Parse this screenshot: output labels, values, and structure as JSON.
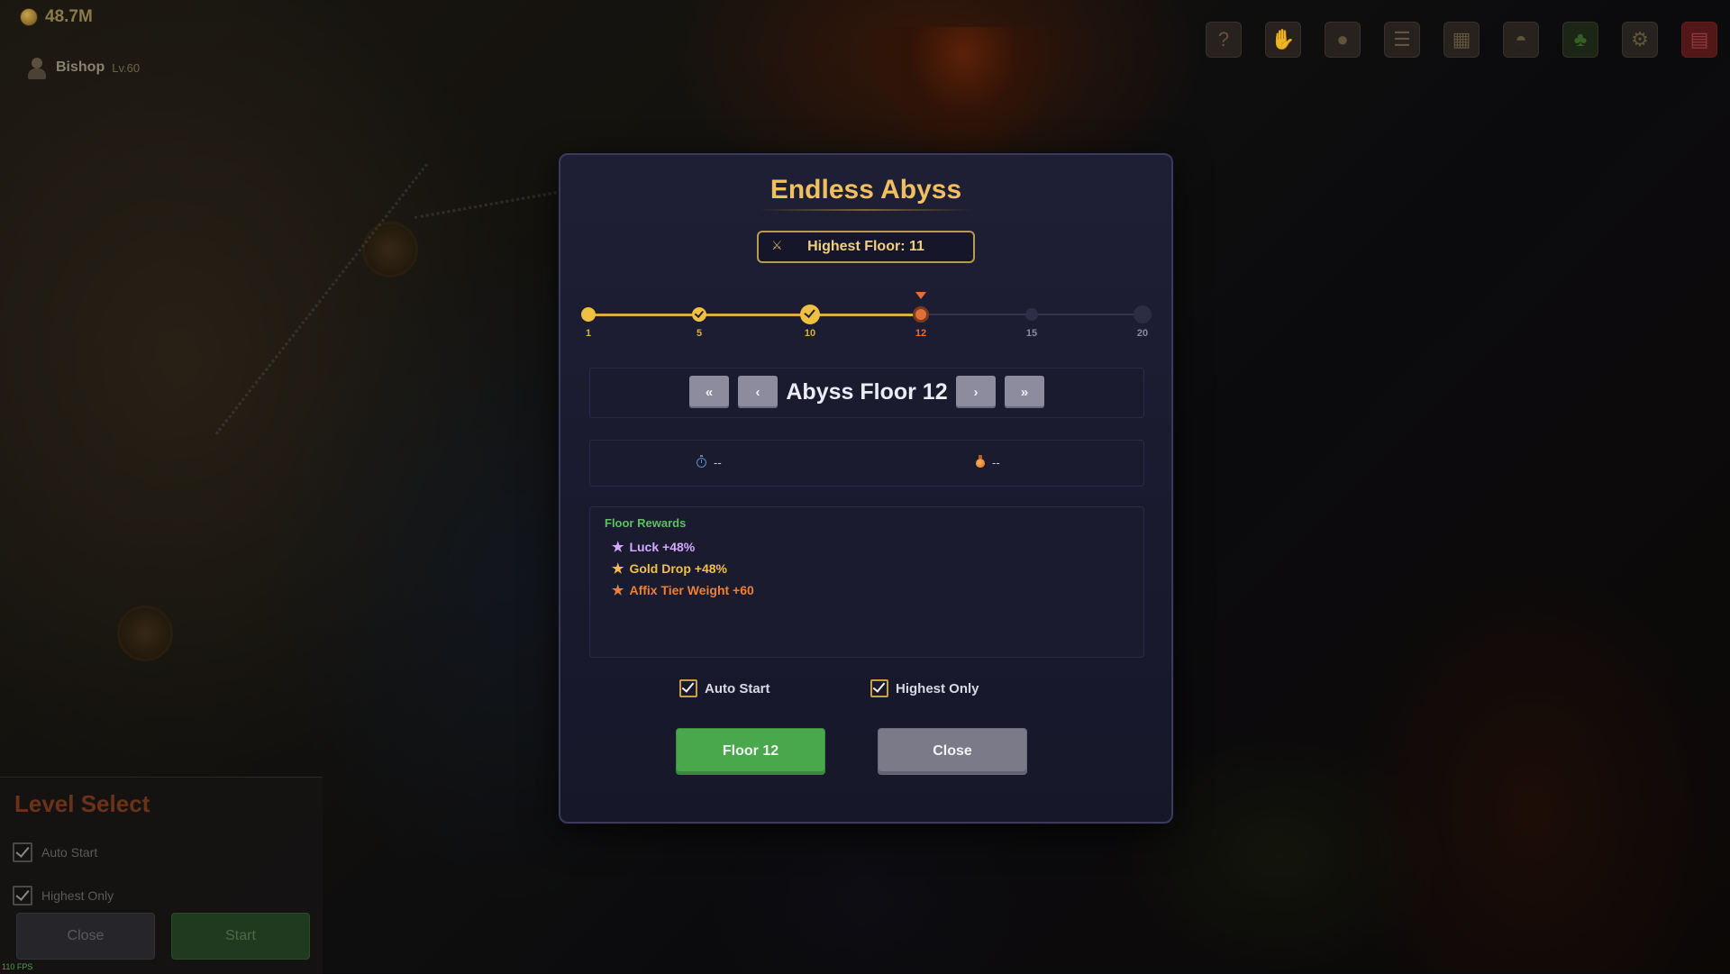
{
  "hud": {
    "gold": "48.7M",
    "player_name": "Bishop",
    "player_level": "Lv.60",
    "toolbar_icons": [
      "help-icon",
      "handshake-icon",
      "orb-icon",
      "list-icon",
      "map-icon",
      "helmet-icon",
      "skill-tree-icon",
      "settings-icon",
      "save-icon"
    ]
  },
  "level_select": {
    "title": "Level Select",
    "auto_start_label": "Auto Start",
    "highest_only_label": "Highest Only",
    "close_label": "Close",
    "start_label": "Start"
  },
  "fps": "110 FPS",
  "modal": {
    "title": "Endless Abyss",
    "highest_floor": "Highest Floor: 11",
    "track": {
      "labels": [
        "1",
        "5",
        "10",
        "12",
        "15",
        "20"
      ],
      "current_floor": 12,
      "max_floor": 20
    },
    "floor_nav": {
      "first_label": "«",
      "prev_label": "‹",
      "floor_name": "Abyss Floor 12",
      "next_label": "›",
      "last_label": "»"
    },
    "stats": {
      "time_value": "--",
      "potion_value": "--"
    },
    "rewards": {
      "title": "Floor Rewards",
      "items": [
        {
          "text": "Luck +48%",
          "color": "#d4a8ff"
        },
        {
          "text": "Gold Drop +48%",
          "color": "#f0c040"
        },
        {
          "text": "Affix Tier Weight +60",
          "color": "#f08030"
        }
      ]
    },
    "options": {
      "auto_start_label": "Auto Start",
      "auto_start_checked": true,
      "highest_only_label": "Highest Only",
      "highest_only_checked": true
    },
    "buttons": {
      "start_label": "Floor 12",
      "close_label": "Close"
    }
  },
  "colors": {
    "accent_gold": "#f0c060",
    "start_green": "#4aa84c",
    "current_orange": "#e0703a"
  }
}
